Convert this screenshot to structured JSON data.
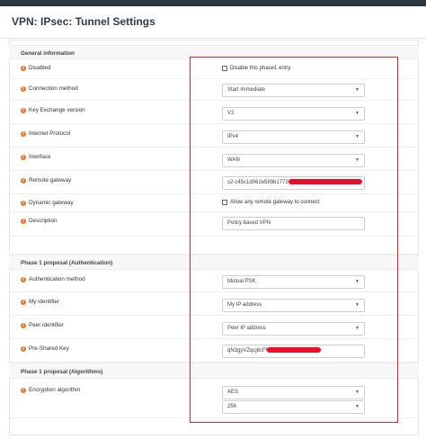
{
  "title": "VPN: IPsec: Tunnel Settings",
  "sections": {
    "general": "General information",
    "phase1_auth": "Phase 1 proposal (Authentication)",
    "phase1_algo": "Phase 1 proposal (Algorithms)"
  },
  "fields": {
    "disabled": {
      "label": "Disabled",
      "checkbox_label": "Disable this phase1 entry",
      "checked": false
    },
    "connection_method": {
      "label": "Connection method",
      "value": "Start immediate"
    },
    "key_exchange": {
      "label": "Key Exchange version",
      "value": "V2"
    },
    "internet_protocol": {
      "label": "Internet Protocol",
      "value": "IPv4"
    },
    "interface": {
      "label": "Interface",
      "value": "WAN"
    },
    "remote_gateway": {
      "label": "Remote gateway",
      "value": "s2-c45c1d062e589b1773"
    },
    "dynamic_gateway": {
      "label": "Dynamic gateway",
      "checkbox_label": "Allow any remote gateway to connect",
      "checked": false
    },
    "description": {
      "label": "Description",
      "value": "Policy based VPN"
    },
    "auth_method": {
      "label": "Authentication method",
      "value": "Mutual PSK"
    },
    "my_identifier": {
      "label": "My identifier",
      "value": "My IP address"
    },
    "peer_identifier": {
      "label": "Peer identifier",
      "value": "Peer IP address"
    },
    "psk": {
      "label": "Pre-Shared Key",
      "value": "qN3gyVZqcj6cFf"
    },
    "encryption": {
      "label": "Encryption algorithm",
      "value": "AES",
      "key_length": "256"
    }
  },
  "icons": {
    "info": "info-icon",
    "caret": "chevron-down-icon"
  },
  "colors": {
    "highlight": "#e0262d",
    "info": "#e27730",
    "redaction": "#e8102b"
  }
}
